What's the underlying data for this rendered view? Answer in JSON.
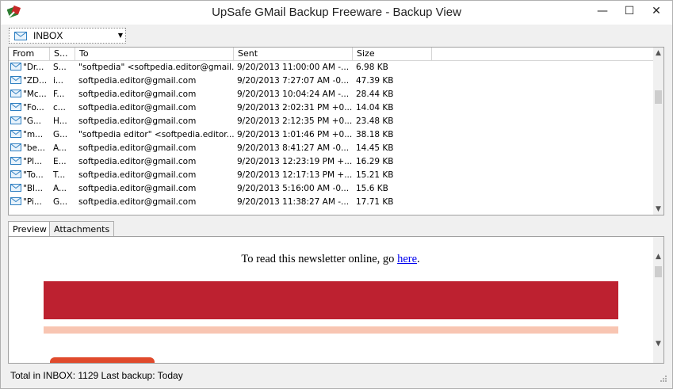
{
  "window": {
    "title": "UpSafe GMail Backup Freeware - Backup View",
    "min_glyph": "—",
    "max_glyph": "☐",
    "close_glyph": "✕"
  },
  "folder_select": {
    "value": "INBOX",
    "icon": "envelope-icon"
  },
  "columns": [
    "From",
    "S...",
    "To",
    "Sent",
    "Size"
  ],
  "messages": [
    {
      "from": "\"Dr...",
      "subject": "S...",
      "to": "\"softpedia\" <softpedia.editor@gmail...",
      "sent": "9/20/2013 11:00:00 AM -...",
      "size": "6.98 KB"
    },
    {
      "from": "\"ZD...",
      "subject": "i...",
      "to": "softpedia.editor@gmail.com",
      "sent": "9/20/2013 7:27:07 AM -0...",
      "size": "47.39 KB"
    },
    {
      "from": "\"Mc...",
      "subject": "F...",
      "to": "softpedia.editor@gmail.com",
      "sent": "9/20/2013 10:04:24 AM -...",
      "size": "28.44 KB"
    },
    {
      "from": "\"Fo...",
      "subject": "c...",
      "to": "softpedia.editor@gmail.com",
      "sent": "9/20/2013 2:02:31 PM +0...",
      "size": "14.04 KB"
    },
    {
      "from": "\"G...",
      "subject": "H...",
      "to": "softpedia.editor@gmail.com",
      "sent": "9/20/2013 2:12:35 PM +0...",
      "size": "23.48 KB"
    },
    {
      "from": "\"m...",
      "subject": "G...",
      "to": "\"softpedia editor\" <softpedia.editor...",
      "sent": "9/20/2013 1:01:46 PM +0...",
      "size": "38.18 KB"
    },
    {
      "from": "\"be...",
      "subject": "A...",
      "to": "softpedia.editor@gmail.com",
      "sent": "9/20/2013 8:41:27 AM -0...",
      "size": "14.45 KB"
    },
    {
      "from": "\"Pl...",
      "subject": "E...",
      "to": "softpedia.editor@gmail.com",
      "sent": "9/20/2013 12:23:19 PM +...",
      "size": "16.29 KB"
    },
    {
      "from": "\"To...",
      "subject": "T...",
      "to": "softpedia.editor@gmail.com",
      "sent": "9/20/2013 12:17:13 PM +...",
      "size": "15.21 KB"
    },
    {
      "from": "\"Bl...",
      "subject": "A...",
      "to": "softpedia.editor@gmail.com",
      "sent": "9/20/2013 5:16:00 AM -0...",
      "size": "15.6 KB"
    },
    {
      "from": "\"Pi...",
      "subject": "G...",
      "to": "softpedia.editor@gmail.com",
      "sent": "9/20/2013 11:38:27 AM -...",
      "size": "17.71 KB"
    }
  ],
  "tabs": [
    "Preview",
    "Attachments"
  ],
  "preview": {
    "text": "To read this newsletter online, go ",
    "link": "here",
    "tail": "."
  },
  "status": "Total in INBOX: 1129  Last backup: Today",
  "colors": {
    "banner_red": "#bd2130",
    "banner_pink": "#f8c5b2",
    "button_orange": "#e04a2c",
    "link_blue": "#0000ee"
  }
}
